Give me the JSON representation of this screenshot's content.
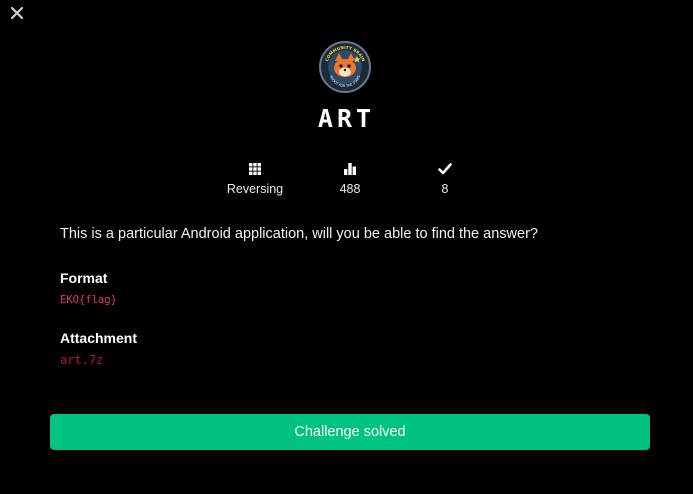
{
  "modal": {
    "close_icon": "close-icon",
    "logo_icon": "ctf-logo-icon",
    "logo_text_top": "COMMUNITY BRAIN",
    "logo_text_bottom": "SHOOT FOR THE STARS"
  },
  "challenge": {
    "title": "ART",
    "stats": [
      {
        "icon": "grid-icon",
        "label": "Reversing"
      },
      {
        "icon": "bar-chart-icon",
        "label": "488"
      },
      {
        "icon": "checkmark-icon",
        "label": "8"
      }
    ],
    "description": "This is a particular Android application, will you be able to find the answer?",
    "format_heading": "Format",
    "format_value": "EKO{flag}",
    "attachment_heading": "Attachment",
    "attachment_name": "art.7z",
    "status_button_label": "Challenge solved"
  },
  "colors": {
    "background": "#000000",
    "accent_green": "#00c281",
    "format_pink": "#e8336b",
    "attachment_red": "#b3163f"
  }
}
